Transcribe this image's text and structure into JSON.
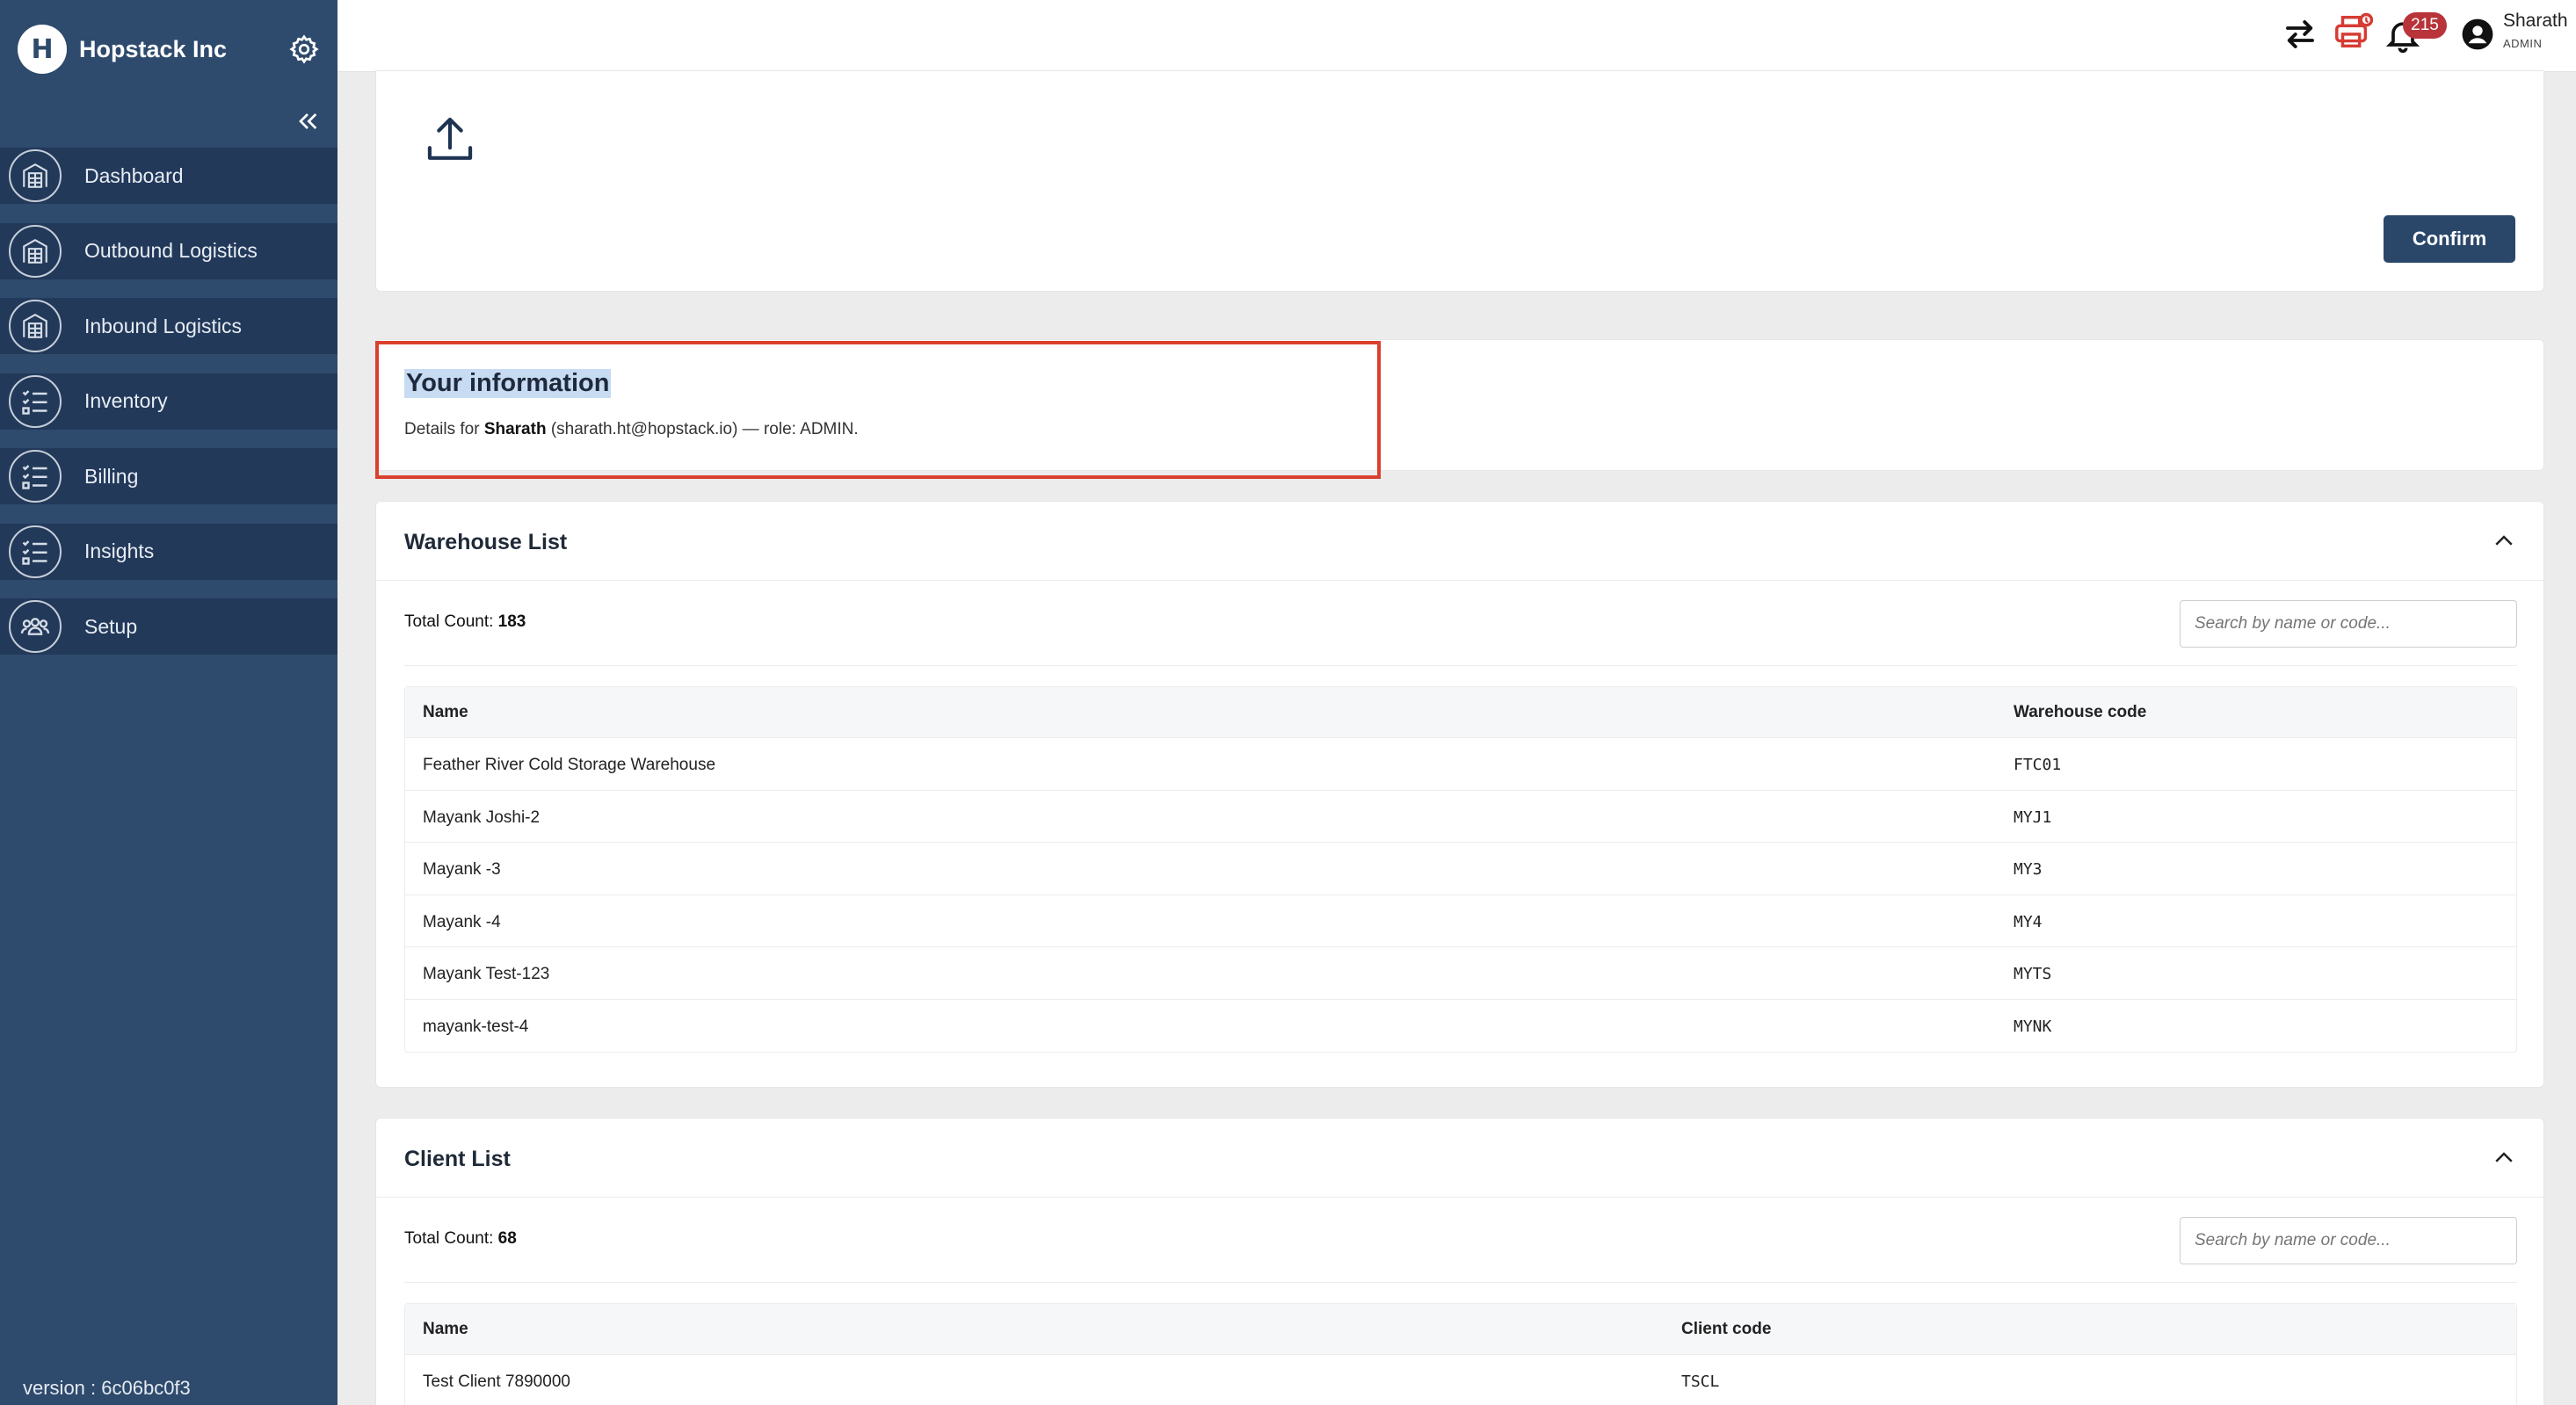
{
  "app": {
    "brand": "Hopstack Inc",
    "logo_letter": "H",
    "version": "version : 6c06bc0f3"
  },
  "sidebar": {
    "items": [
      {
        "label": "Dashboard",
        "icon": "warehouse-icon"
      },
      {
        "label": "Outbound Logistics",
        "icon": "warehouse-icon"
      },
      {
        "label": "Inbound Logistics",
        "icon": "warehouse-icon"
      },
      {
        "label": "Inventory",
        "icon": "checklist-icon"
      },
      {
        "label": "Billing",
        "icon": "checklist-icon"
      },
      {
        "label": "Insights",
        "icon": "checklist-icon"
      },
      {
        "label": "Setup",
        "icon": "people-icon"
      }
    ]
  },
  "topbar": {
    "notification_count": "215",
    "user_name": "Sharath",
    "user_role": "ADMIN"
  },
  "upload": {
    "confirm_label": "Confirm"
  },
  "info": {
    "title": "Your information",
    "details_prefix": "Details for ",
    "details_name": "Sharath",
    "details_suffix": " (sharath.ht@hopstack.io) — role: ADMIN."
  },
  "warehouses": {
    "title": "Warehouse List",
    "total_label": "Total Count: ",
    "total_value": "183",
    "search_placeholder": "Search by name or code...",
    "columns": [
      "Name",
      "Warehouse code"
    ],
    "rows": [
      {
        "name": "Feather River Cold Storage Warehouse",
        "code": "FTC01"
      },
      {
        "name": "Mayank Joshi-2",
        "code": "MYJ1"
      },
      {
        "name": "Mayank -3",
        "code": "MY3"
      },
      {
        "name": "Mayank -4",
        "code": "MY4"
      },
      {
        "name": "Mayank Test-123",
        "code": "MYTS"
      },
      {
        "name": "mayank-test-4",
        "code": "MYNK"
      }
    ]
  },
  "clients": {
    "title": "Client List",
    "total_label": "Total Count: ",
    "total_value": "68",
    "search_placeholder": "Search by name or code...",
    "columns": [
      "Name",
      "Client code"
    ],
    "rows": [
      {
        "name": "Test Client 7890000",
        "code": "TSCL"
      }
    ]
  }
}
